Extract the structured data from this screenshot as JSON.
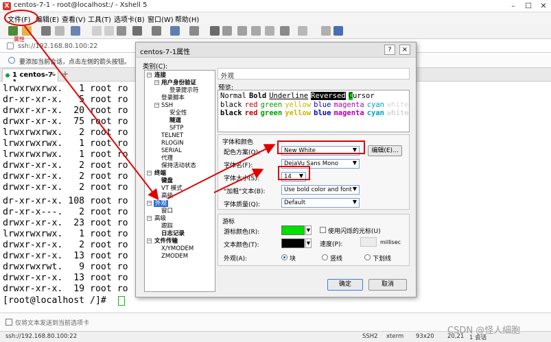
{
  "window": {
    "title": "centos-7-1 - root@localhost:/ - Xshell 5",
    "app_icon": "X"
  },
  "menu": [
    "文件(F)",
    "编辑(E)",
    "查看(V)",
    "工具(T)",
    "选项卡(B)",
    "窗口(W)",
    "帮助(H)"
  ],
  "address": {
    "url": "ssh://192.168.80.100:22",
    "tip": "属性"
  },
  "infobar": {
    "text": "要添加当前会话，点击左侧的箭头按钮。"
  },
  "tab": {
    "label": "1 centos-7-1",
    "close": "×",
    "add": "+"
  },
  "terminal": {
    "lines": [
      "lrwxrwxrwx.   1 root ro",
      "dr-xr-xr-x.   5 root ro",
      "drwxr-xr-x.  20 root ro",
      "drwxr-xr-x.  75 root ro",
      "lrwxrwxrwx.   2 root ro",
      "lrwxrwxrwx.   1 root ro",
      "lrwxrwxrwx.   1 root ro",
      "drwxr-xr-x.   2 root ro",
      "drwxr-xr-x.   2 root ro",
      "drwxr-xr-x.   2 root ro",
      "dr-xr-xr-x. 108 root ro",
      "dr-xr-x---.   2 root ro",
      "drwxr-xr-x.  23 root ro",
      "lrwxrwxrwx.   1 root ro",
      "drwxr-xr-x.   2 root ro",
      "drwxr-xr-x.  13 root ro",
      "drwxrwxrwt.   9 root ro",
      "drwxr-xr-x.  13 root ro",
      "drwxr-xr-x.  19 root ro"
    ],
    "prompt": "[root@localhost /]# "
  },
  "inputbar": {
    "text": "仅将文本发送到当前选项卡"
  },
  "status": {
    "connection": "ssh://192.168.80.100:22",
    "protocol": "SSH2",
    "term": "xterm",
    "size": "93x20",
    "pos": "20,21",
    "sessions": "1 会话"
  },
  "watermark": "CSDN @怪人細胞",
  "dialog": {
    "title": "centos-7-1属性",
    "help": "?",
    "close": "×",
    "category_label": "类别(C):",
    "tree": {
      "connection": "连接",
      "auth": "用户身份验证",
      "login_prompt": "登录提示符",
      "login_script": "登录脚本",
      "ssh": "SSH",
      "security": "安全性",
      "tunnel": "隧道",
      "sftp": "SFTP",
      "telnet": "TELNET",
      "rlogin": "RLOGIN",
      "serial": "SERIAL",
      "proxy": "代理",
      "keepalive": "保持活动状态",
      "terminal": "终端",
      "keyboard": "键盘",
      "vt_modes": "VT 模式",
      "advanced": "高级",
      "appearance": "外观",
      "window": "窗口",
      "advanced2": "高级",
      "tracing": "跟踪",
      "logging": "日志记录",
      "file_transfer": "文件传输",
      "xymodem": "X/YMODEM",
      "zmodem": "ZMODEM"
    },
    "panel_title": "外观",
    "preview_label": "预览:",
    "preview": {
      "normal": "Normal",
      "bold": "Bold",
      "underline": "Underline",
      "reversed": "Reversed",
      "cursor_c": "C",
      "cursor_rest": "ursor",
      "colors": [
        "black",
        "red",
        "green",
        "yellow",
        "blue",
        "magenta",
        "cyan",
        "white"
      ],
      "color_hex": [
        "#000000",
        "#c00000",
        "#00a000",
        "#c8b400",
        "#0000d0",
        "#b000b0",
        "#00a0c0",
        "#d8d8d8"
      ]
    },
    "font_group": {
      "title": "字体和颜色",
      "scheme_label": "配色方案(O):",
      "scheme_value": "New White",
      "edit_button": "编辑(E)...",
      "font_label": "字体名(F):",
      "font_value": "DejaVu Sans Mono",
      "size_label": "字体大小(S):",
      "size_value": "14",
      "bold_label": "\"加粗\"文本(B):",
      "bold_value": "Use bold color and font",
      "quality_label": "字体质量(Q):",
      "quality_value": "Default"
    },
    "cursor_group": {
      "title": "游标",
      "cursor_color_label": "游标颜色(R):",
      "cursor_color": "#00e000",
      "blink_label": "使用闪烁的光标(U)",
      "text_color_label": "文本颜色(T):",
      "text_color": "#000000",
      "speed_label": "速度(P):",
      "speed_unit": "millisec",
      "shape_label": "外观(A):",
      "shape_block": "块",
      "shape_vline": "竖线",
      "shape_underline": "下划线"
    },
    "ok": "确定",
    "cancel": "取消"
  }
}
